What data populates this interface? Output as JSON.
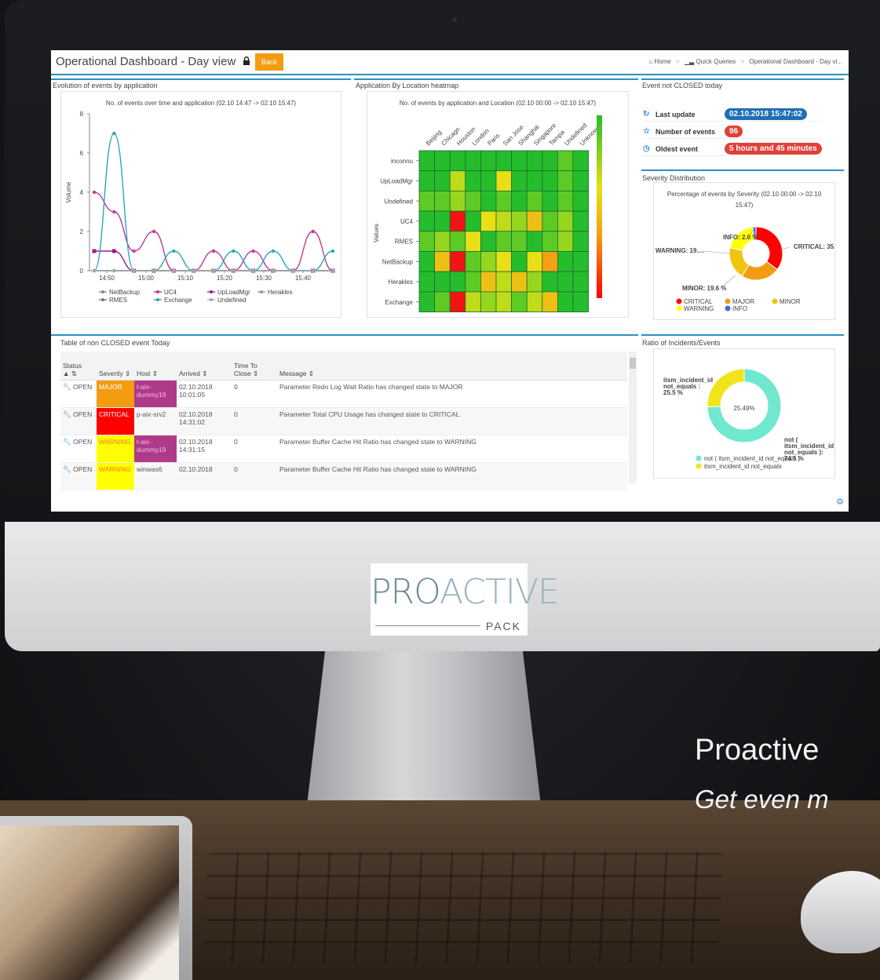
{
  "header": {
    "title": "Operational Dashboard - Day view",
    "back_label": "Back",
    "breadcrumb": [
      "Home",
      "Quick Queries",
      "Operational Dashboard - Day vi..."
    ]
  },
  "panels": {
    "evolution": "Evolution of events by application",
    "heatmap": "Application By Location heatmap",
    "not_closed": "Event not CLOSED today",
    "severity": "Severity Distribution",
    "table": "Table of non CLOSED event Today",
    "ratio": "Ratio of Incidents/Events"
  },
  "event_info": {
    "last_update_label": "Last update",
    "last_update_value": "02.10.2018 15:47:02",
    "number_label": "Number of events",
    "number_value": "96",
    "oldest_label": "Oldest event",
    "oldest_value": "5 hours and 45 minutes"
  },
  "table": {
    "headers": {
      "status": "Status",
      "severity": "Severity",
      "host": "Host",
      "arrived": "Arrived",
      "ttc": "Time To Close",
      "message": "Message"
    },
    "rows": [
      {
        "status": "OPEN",
        "severity": "MAJOR",
        "host": "t-aix-dummy19",
        "arrived": "02.10.2018 10:01:05",
        "ttc": "0",
        "message": "Parameter Redo Log Wait Ratio has changed state to MAJOR"
      },
      {
        "status": "OPEN",
        "severity": "CRITICAL",
        "host": "p-aix-srv2",
        "arrived": "02.10.2018 14:31:02",
        "ttc": "0",
        "message": "Parameter Total CPU Usage has changed state to CRITICAL"
      },
      {
        "status": "OPEN",
        "severity": "WARNING",
        "host": "t-aix-dummy19",
        "arrived": "02.10.2018 14:31:15",
        "ttc": "0",
        "message": "Parameter Buffer Cache Hit Ratio has changed state to WARNING"
      },
      {
        "status": "OPEN",
        "severity": "WARNING",
        "host": "winwas6",
        "arrived": "02.10.2018",
        "ttc": "0",
        "message": "Parameter Buffer Cache Hit Ratio has changed state to WARNING"
      }
    ]
  },
  "branding": {
    "logo_pro": "PRO",
    "logo_active": "ACTIVE",
    "logo_pack": "PACK",
    "tagline": "Proactive",
    "tagline2": "Get even m"
  },
  "colors": {
    "accent": "#2a91c4",
    "critical": "#ff0000",
    "major": "#f39c12",
    "minor": "#f1c40f",
    "warning": "#ffff00",
    "info": "#3b6fd9",
    "exchange": "#2aa8b4",
    "uc4": "#c0399b"
  },
  "chart_data": [
    {
      "type": "line",
      "title": "No. of events over time and application (02.10 14:47 -> 02.10 15:47)",
      "ylabel": "Volume",
      "ylim": [
        0,
        8
      ],
      "yticks": [
        0,
        2,
        4,
        6,
        8
      ],
      "xticks": [
        "14:50",
        "15:00",
        "15:10",
        "15:20",
        "15:30",
        "15:40"
      ],
      "x": [
        "14:47",
        "14:52",
        "14:57",
        "15:02",
        "15:07",
        "15:12",
        "15:17",
        "15:22",
        "15:27",
        "15:32",
        "15:37",
        "15:42",
        "15:47"
      ],
      "series": [
        {
          "name": "NetBackup",
          "values": [
            0,
            0,
            0,
            0,
            0,
            0,
            0,
            0,
            0,
            0,
            0,
            0,
            0
          ]
        },
        {
          "name": "UC4",
          "values": [
            4,
            3,
            1,
            2,
            0,
            0,
            1,
            0,
            1,
            0,
            0,
            2,
            0
          ]
        },
        {
          "name": "UpLoadMgr",
          "values": [
            1,
            1,
            0,
            0,
            0,
            0,
            0,
            0,
            0,
            0,
            0,
            0,
            0
          ]
        },
        {
          "name": "Herakles",
          "values": [
            0,
            0,
            0,
            0,
            0,
            0,
            0,
            0,
            0,
            0,
            0,
            0,
            0
          ]
        },
        {
          "name": "RMES",
          "values": [
            0,
            0,
            0,
            0,
            0,
            0,
            0,
            0,
            0,
            0,
            0,
            0,
            0
          ]
        },
        {
          "name": "Exchange",
          "values": [
            0,
            7,
            0,
            0,
            1,
            0,
            0,
            1,
            0,
            1,
            0,
            0,
            1
          ]
        },
        {
          "name": "Undefined",
          "values": [
            0,
            0,
            0,
            0,
            0,
            0,
            0,
            0,
            0,
            0,
            0,
            0,
            0
          ]
        }
      ]
    },
    {
      "type": "heatmap",
      "title": "No. of events by application and Location (02.10 00:00 -> 02.10 15:47)",
      "ylabel": "Values",
      "x": [
        "Beijing",
        "Chicago",
        "Houston",
        "London",
        "Paris",
        "San Jose",
        "Shanghai",
        "Singapore",
        "Tampa",
        "Undefined",
        "Unknown"
      ],
      "y": [
        "inconnu",
        "UpLoadMgr",
        "Undefined",
        "UC4",
        "RMES",
        "NetBackup",
        "Herakles",
        "Exchange"
      ],
      "values": [
        [
          0,
          0,
          0,
          0,
          0,
          0,
          0,
          0,
          0,
          1,
          0
        ],
        [
          0,
          0,
          3,
          0,
          0,
          4,
          0,
          0,
          0,
          1,
          0
        ],
        [
          1,
          1,
          2,
          1,
          0,
          1,
          0,
          1,
          0,
          1,
          0
        ],
        [
          0,
          0,
          8,
          0,
          4,
          3,
          2,
          5,
          1,
          2,
          0
        ],
        [
          1,
          2,
          1,
          4,
          0,
          1,
          1,
          0,
          1,
          2,
          0
        ],
        [
          0,
          5,
          8,
          1,
          2,
          4,
          0,
          4,
          6,
          0,
          0
        ],
        [
          0,
          0,
          0,
          1,
          5,
          3,
          5,
          2,
          0,
          0,
          0
        ],
        [
          0,
          1,
          8,
          3,
          2,
          3,
          1,
          3,
          5,
          0,
          0
        ]
      ]
    },
    {
      "type": "pie",
      "title": "Percentage of events by Severity (02.10 00:00 -> 02.10 15:47)",
      "categories": [
        "CRITICAL",
        "MAJOR",
        "MINOR",
        "WARNING",
        "INFO"
      ],
      "values": [
        35.3,
        23.5,
        19.6,
        19.6,
        2.0
      ],
      "data_labels": [
        "CRITICAL: 35.3 %",
        "",
        "MINOR: 19.6 %",
        "WARNING: 19....",
        "INFO: 2.0 %"
      ]
    },
    {
      "type": "pie",
      "center_label": "25.49%",
      "categories": [
        "not ( itsm_incident_id not_equals )",
        "itsm_incident_id not_equals"
      ],
      "values": [
        74.5,
        25.5
      ],
      "data_labels": [
        "not ( itsm_incident_id not_equals ): 74.5 %",
        "itsm_incident_id not_equals : 25.5 %"
      ]
    }
  ]
}
